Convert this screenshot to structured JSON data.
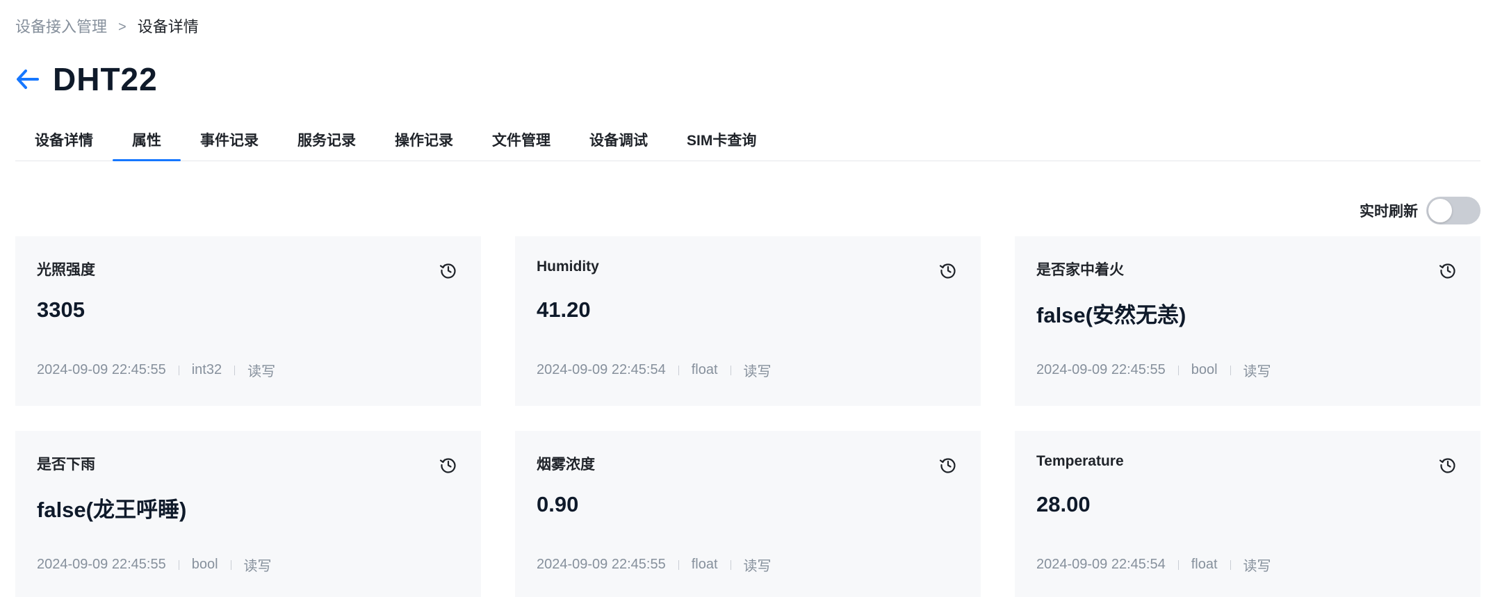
{
  "breadcrumb": {
    "parent": "设备接入管理",
    "separator": ">",
    "current": "设备详情"
  },
  "header": {
    "back_icon": "arrow-left-icon",
    "title": "DHT22"
  },
  "tabs": [
    {
      "label": "设备详情"
    },
    {
      "label": "属性",
      "active": true
    },
    {
      "label": "事件记录"
    },
    {
      "label": "服务记录"
    },
    {
      "label": "操作记录"
    },
    {
      "label": "文件管理"
    },
    {
      "label": "设备调试"
    },
    {
      "label": "SIM卡查询"
    }
  ],
  "realtime": {
    "label": "实时刷新",
    "enabled": false
  },
  "colors": {
    "accent": "#1677ff",
    "card_bg": "#f7f8fa",
    "muted_text": "#86909c"
  },
  "cards": [
    {
      "name": "光照强度",
      "value": "3305",
      "time": "2024-09-09 22:45:55",
      "type": "int32",
      "access": "读写"
    },
    {
      "name": "Humidity",
      "value": "41.20",
      "time": "2024-09-09 22:45:54",
      "type": "float",
      "access": "读写"
    },
    {
      "name": "是否家中着火",
      "value": "false(安然无恙)",
      "time": "2024-09-09 22:45:55",
      "type": "bool",
      "access": "读写"
    },
    {
      "name": "是否下雨",
      "value": "false(龙王呼睡)",
      "time": "2024-09-09 22:45:55",
      "type": "bool",
      "access": "读写"
    },
    {
      "name": "烟雾浓度",
      "value": "0.90",
      "time": "2024-09-09 22:45:55",
      "type": "float",
      "access": "读写"
    },
    {
      "name": "Temperature",
      "value": "28.00",
      "time": "2024-09-09 22:45:54",
      "type": "float",
      "access": "读写"
    }
  ]
}
